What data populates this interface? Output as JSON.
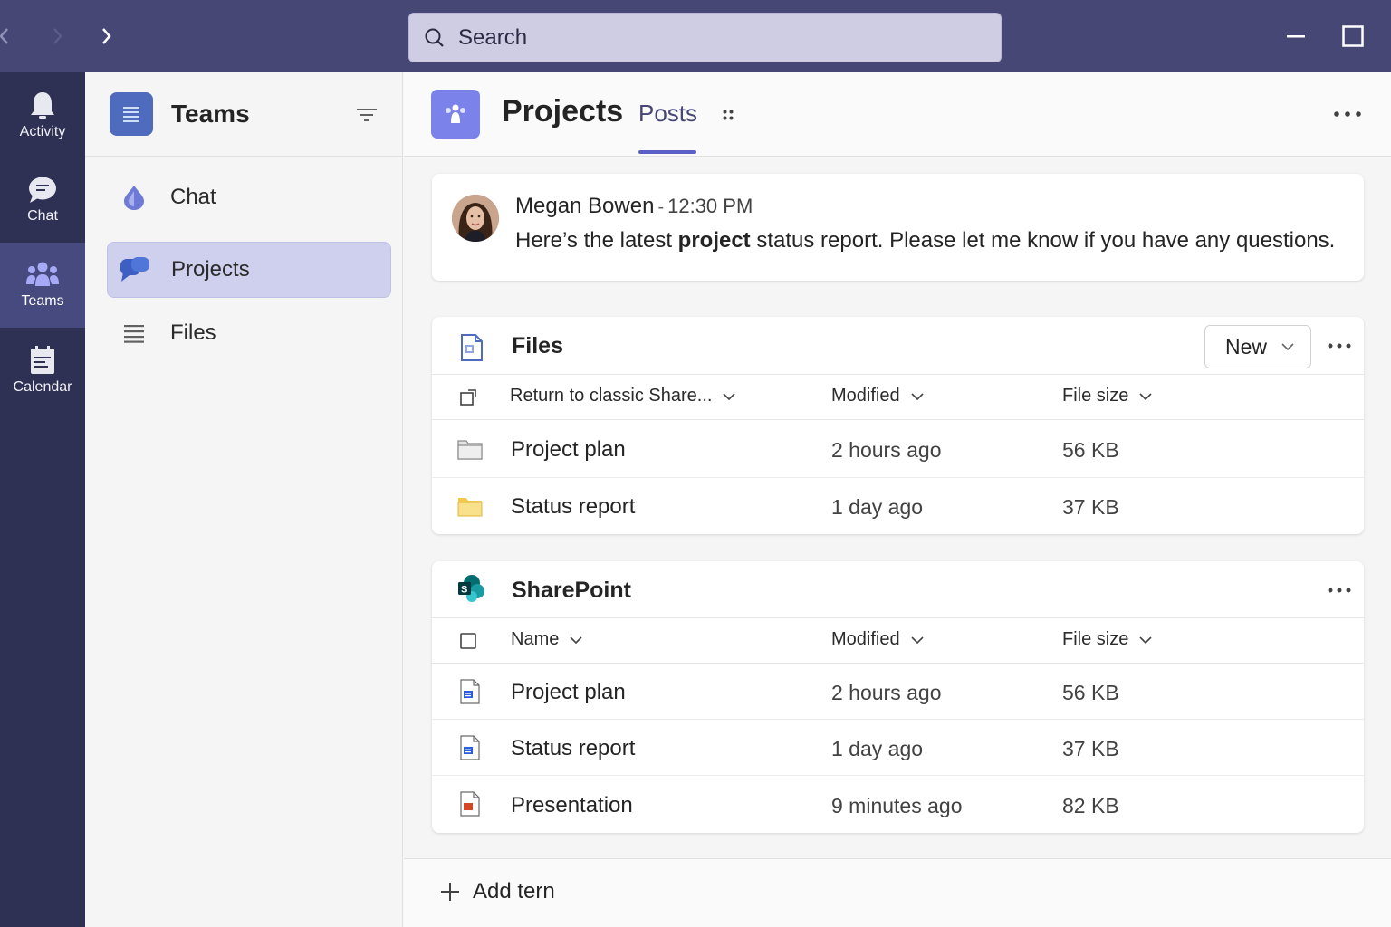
{
  "titlebar": {
    "search_placeholder": "Search",
    "icons": [
      "back-chevron-icon",
      "forward-chevron-icon",
      "search-icon",
      "minimize-icon",
      "maximize-icon"
    ]
  },
  "rail": {
    "items": [
      {
        "label": "Activity",
        "icon": "bell-icon"
      },
      {
        "label": "Chat",
        "icon": "chat-bubble-icon"
      },
      {
        "label": "Teams",
        "icon": "people-icon",
        "active": true
      },
      {
        "label": "Calendar",
        "icon": "calendar-icon"
      }
    ]
  },
  "panel": {
    "title": "Teams",
    "items": [
      {
        "label": "Chat",
        "icon": "drop-icon"
      },
      {
        "label": "Projects",
        "icon": "team-chat-icon",
        "selected": true
      },
      {
        "label": "Files",
        "icon": "list-icon"
      }
    ]
  },
  "channel": {
    "title": "Projects",
    "tab": "Posts"
  },
  "post": {
    "author": "Megan Bowen",
    "separator": "-",
    "time": "12:30 PM",
    "body_before": "Here’s the latest ",
    "body_bold": "project",
    "body_after": " status report. Please let me know if you have any questions."
  },
  "files": {
    "title": "Files",
    "new_label": "New",
    "columns": {
      "name": "Return to classic Share...",
      "modified": "Modified",
      "size": "File size"
    },
    "rows": [
      {
        "name": "Project plan",
        "modified": "2 hours ago",
        "size": "56 KB",
        "icon": "folder-gray-icon"
      },
      {
        "name": "Status report",
        "modified": "1 day ago",
        "size": "37 KB",
        "icon": "folder-yellow-icon"
      }
    ]
  },
  "sharepoint": {
    "title": "SharePoint",
    "columns": {
      "name": "Name",
      "modified": "Modified",
      "size": "File size"
    },
    "rows": [
      {
        "name": "Project plan",
        "modified": "2 hours ago",
        "size": "56 KB",
        "icon": "word-doc-icon"
      },
      {
        "name": "Status report",
        "modified": "1 day ago",
        "size": "37 KB",
        "icon": "word-doc-icon"
      },
      {
        "name": "Presentation",
        "modified": "9 minutes ago",
        "size": "82 KB",
        "icon": "powerpoint-doc-icon"
      }
    ]
  },
  "footer": {
    "add_label": "Add tern"
  },
  "colors": {
    "titlebar": "#464775",
    "rail": "#2e3154",
    "accent": "#5b5fc7",
    "selected_item": "#cfd0ee"
  }
}
